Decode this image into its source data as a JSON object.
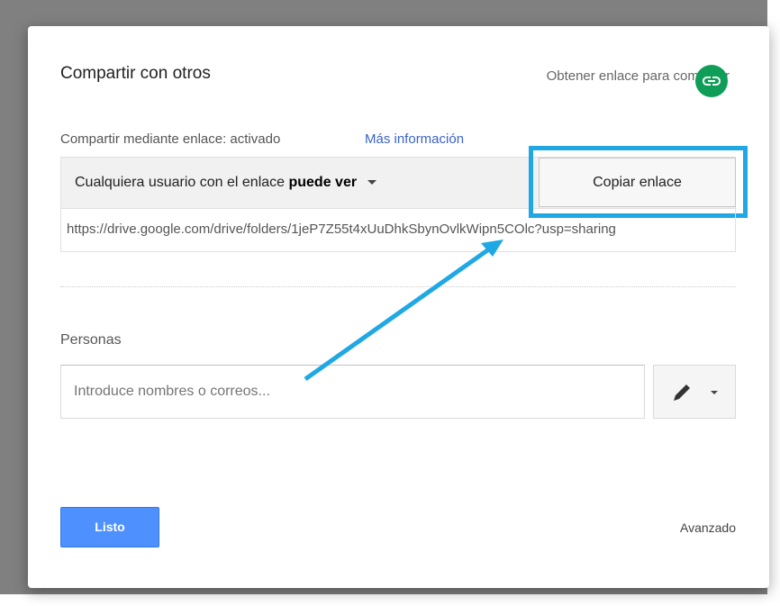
{
  "dialog": {
    "title": "Compartir con otros",
    "get_link_label": "Obtener enlace para compartir",
    "link_icon": "link-icon",
    "link_sharing_status": "Compartir mediante enlace: activado",
    "more_info_link": "Más información",
    "access_prefix": "Cualquiera usuario con el enlace ",
    "access_level": "puede ver",
    "copy_link_button": "Copiar enlace",
    "share_url": "https://drive.google.com/drive/folders/1jeP7Z55t4xUuDhkSbynOvlkWipn5COlc?usp=sharing",
    "people_label": "Personas",
    "people_input_placeholder": "Introduce nombres o correos...",
    "permission_icon": "pencil-icon",
    "done_button": "Listo",
    "advanced_link": "Avanzado"
  },
  "annotation": {
    "highlight_color": "#1fa8e3",
    "arrow_color": "#1fa8e3"
  },
  "colors": {
    "accent_blue": "#4d90fe",
    "link_green": "#0f9d58",
    "link_text": "#3b63c7"
  }
}
